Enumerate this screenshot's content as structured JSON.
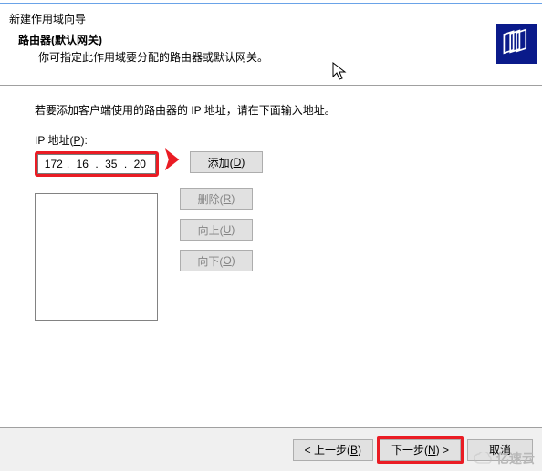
{
  "window": {
    "title": "新建作用域向导"
  },
  "header": {
    "title": "路由器(默认网关)",
    "subtitle": "你可指定此作用域要分配的路由器或默认网关。"
  },
  "body": {
    "intro": "若要添加客户端使用的路由器的 IP 地址，请在下面输入地址。",
    "ip_label_prefix": "IP 地址(",
    "ip_label_key": "P",
    "ip_label_suffix": "):",
    "ip": {
      "o1": "172",
      "o2": "16",
      "o3": "35",
      "o4": "20"
    }
  },
  "buttons": {
    "add_pre": "添加(",
    "add_key": "D",
    "add_post": ")",
    "del_pre": "删除(",
    "del_key": "R",
    "del_post": ")",
    "up_pre": "向上(",
    "up_key": "U",
    "up_post": ")",
    "down_pre": "向下(",
    "down_key": "O",
    "down_post": ")"
  },
  "footer": {
    "back_pre": "< 上一步(",
    "back_key": "B",
    "back_post": ")",
    "next_pre": "下一步(",
    "next_key": "N",
    "next_post": ") >",
    "cancel": "取消"
  },
  "watermark": "亿速云"
}
